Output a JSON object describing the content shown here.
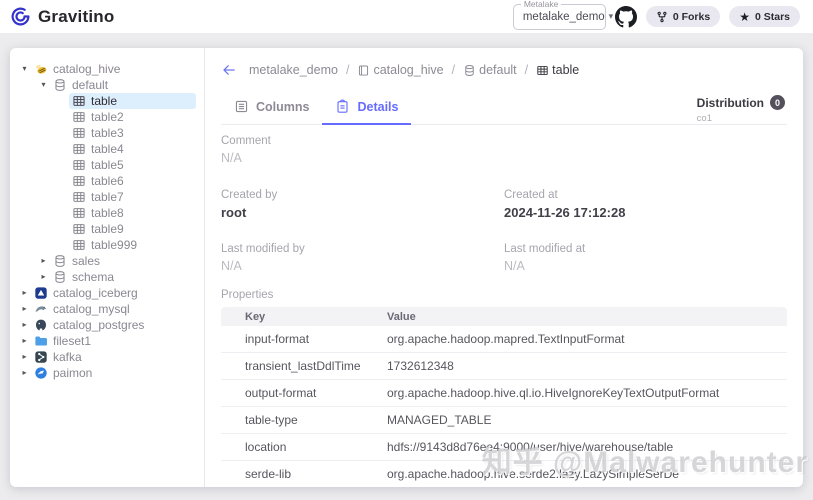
{
  "colors": {
    "primary": "#666CFF",
    "selected_bg": "#ddeefd",
    "logo_blue": "#3333cc"
  },
  "header": {
    "app_name": "Gravitino",
    "metalake": {
      "label": "Metalake",
      "value": "metalake_demo"
    },
    "github": {
      "forks": "0 Forks",
      "stars": "0 Stars"
    }
  },
  "sidebar": {
    "tree": [
      {
        "label": "catalog_hive",
        "icon": "hive-icon",
        "level": 0,
        "arrow": "down",
        "selected": false
      },
      {
        "label": "default",
        "icon": "database-icon",
        "level": 1,
        "arrow": "down",
        "selected": false
      },
      {
        "label": "table",
        "icon": "table-icon",
        "level": 2,
        "arrow": "",
        "selected": true
      },
      {
        "label": "table2",
        "icon": "table-icon",
        "level": 2,
        "arrow": "",
        "selected": false
      },
      {
        "label": "table3",
        "icon": "table-icon",
        "level": 2,
        "arrow": "",
        "selected": false
      },
      {
        "label": "table4",
        "icon": "table-icon",
        "level": 2,
        "arrow": "",
        "selected": false
      },
      {
        "label": "table5",
        "icon": "table-icon",
        "level": 2,
        "arrow": "",
        "selected": false
      },
      {
        "label": "table6",
        "icon": "table-icon",
        "level": 2,
        "arrow": "",
        "selected": false
      },
      {
        "label": "table7",
        "icon": "table-icon",
        "level": 2,
        "arrow": "",
        "selected": false
      },
      {
        "label": "table8",
        "icon": "table-icon",
        "level": 2,
        "arrow": "",
        "selected": false
      },
      {
        "label": "table9",
        "icon": "table-icon",
        "level": 2,
        "arrow": "",
        "selected": false
      },
      {
        "label": "table999",
        "icon": "table-icon",
        "level": 2,
        "arrow": "",
        "selected": false
      },
      {
        "label": "sales",
        "icon": "database-icon",
        "level": 1,
        "arrow": "right",
        "selected": false
      },
      {
        "label": "schema",
        "icon": "database-icon",
        "level": 1,
        "arrow": "right",
        "selected": false
      },
      {
        "label": "catalog_iceberg",
        "icon": "iceberg-icon",
        "level": 0,
        "arrow": "right",
        "selected": false
      },
      {
        "label": "catalog_mysql",
        "icon": "mysql-icon",
        "level": 0,
        "arrow": "right",
        "selected": false
      },
      {
        "label": "catalog_postgres",
        "icon": "postgres-icon",
        "level": 0,
        "arrow": "right",
        "selected": false
      },
      {
        "label": "fileset1",
        "icon": "folder-icon",
        "level": 0,
        "arrow": "right",
        "selected": false
      },
      {
        "label": "kafka",
        "icon": "kafka-icon",
        "level": 0,
        "arrow": "right",
        "selected": false
      },
      {
        "label": "paimon",
        "icon": "paimon-icon",
        "level": 0,
        "arrow": "right",
        "selected": false
      }
    ]
  },
  "main": {
    "breadcrumb": [
      {
        "label": "metalake_demo",
        "icon": ""
      },
      {
        "label": "catalog_hive",
        "icon": "catalog-icon"
      },
      {
        "label": "default",
        "icon": "database-icon"
      },
      {
        "label": "table",
        "icon": "table-icon"
      }
    ],
    "tabs": [
      {
        "label": "Columns",
        "icon": "columns-tab-icon",
        "active": false
      },
      {
        "label": "Details",
        "icon": "details-tab-icon",
        "active": true
      }
    ],
    "distribution": {
      "label": "Distribution",
      "count": "0",
      "detail": "co1"
    },
    "details": {
      "comment": {
        "label": "Comment",
        "value": "N/A"
      },
      "created_by": {
        "label": "Created by",
        "value": "root"
      },
      "created_at": {
        "label": "Created at",
        "value": "2024-11-26 17:12:28"
      },
      "last_modified_by": {
        "label": "Last modified by",
        "value": "N/A"
      },
      "last_modified_at": {
        "label": "Last modified at",
        "value": "N/A"
      }
    },
    "properties": {
      "label": "Properties",
      "columns": [
        "Key",
        "Value"
      ],
      "rows": [
        {
          "key": "input-format",
          "value": "org.apache.hadoop.mapred.TextInputFormat"
        },
        {
          "key": "transient_lastDdlTime",
          "value": "1732612348"
        },
        {
          "key": "output-format",
          "value": "org.apache.hadoop.hive.ql.io.HiveIgnoreKeyTextOutputFormat"
        },
        {
          "key": "table-type",
          "value": "MANAGED_TABLE"
        },
        {
          "key": "location",
          "value": "hdfs://9143d8d76ee4:9000/user/hive/warehouse/table"
        },
        {
          "key": "serde-lib",
          "value": "org.apache.hadoop.hive.serde2.lazy.LazySimpleSerDe"
        }
      ]
    }
  },
  "watermark": "知乎 @Malwarehunter"
}
